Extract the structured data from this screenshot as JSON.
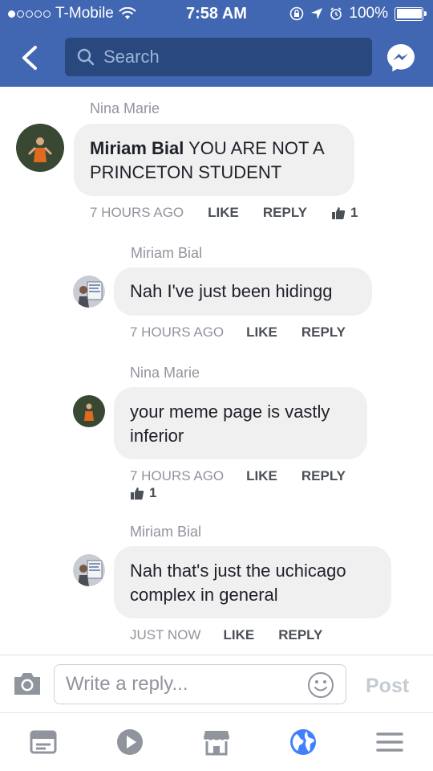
{
  "status_bar": {
    "carrier": "T-Mobile",
    "time": "7:58 AM",
    "battery": "100%"
  },
  "header": {
    "search_placeholder": "Search"
  },
  "comments": [
    {
      "author": "Nina Marie",
      "inline_author": "Miriam Bial",
      "text": " YOU ARE NOT A PRINCETON STUDENT",
      "time": "7 HOURS AGO",
      "like_label": "LIKE",
      "reply_label": "REPLY",
      "like_count": "1"
    },
    {
      "author": "Miriam Bial",
      "text": "Nah I've just been hidingg",
      "time": "7 HOURS AGO",
      "like_label": "LIKE",
      "reply_label": "REPLY"
    },
    {
      "author": "Nina Marie",
      "text": "your meme page is vastly inferior",
      "time": "7 HOURS AGO",
      "like_label": "LIKE",
      "reply_label": "REPLY",
      "like_count": "1"
    },
    {
      "author": "Miriam Bial",
      "text": "Nah that's just the uchicago complex in general",
      "time": "JUST NOW",
      "like_label": "LIKE",
      "reply_label": "REPLY"
    }
  ],
  "reply_bar": {
    "placeholder": "Write a reply...",
    "post_label": "Post"
  },
  "tabbar": {
    "icons": [
      "news-feed-icon",
      "video-icon",
      "marketplace-icon",
      "notifications-globe-icon",
      "menu-icon"
    ]
  },
  "colors": {
    "brand_blue": "#4267b2",
    "search_bg": "#29487d",
    "bubble_bg": "#f1f0f0",
    "meta_gray": "#90949c",
    "active_tab": "#4080ff"
  }
}
